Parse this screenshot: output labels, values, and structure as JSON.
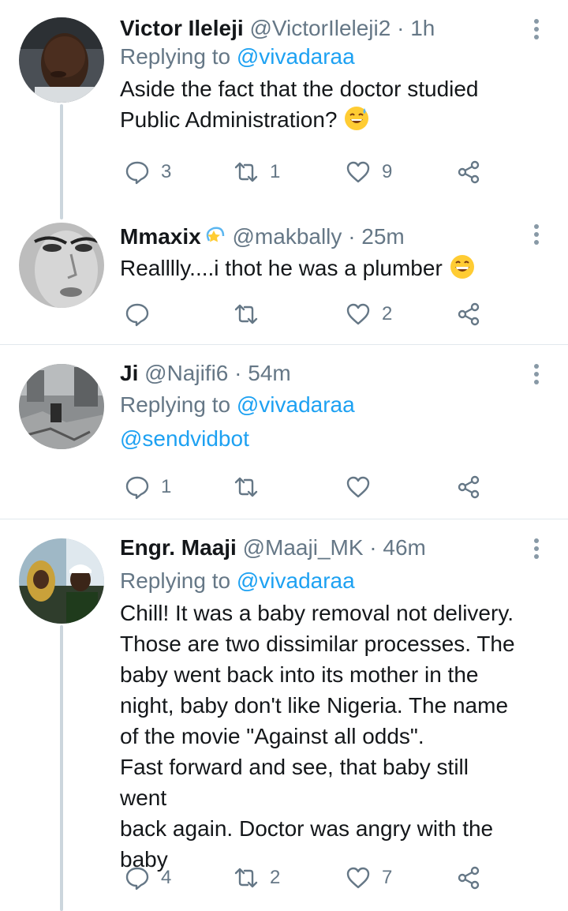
{
  "tweets": [
    {
      "name": "Victor Ileleji",
      "handle": "@VictorIleleji2",
      "time": "· 1h",
      "replying_prefix": "Replying to",
      "replying_to": "@vivadaraa",
      "text_lines": [
        "Aside the fact that the doctor studied",
        "Public Administration?"
      ],
      "emoji": "grinning-sweat-emoji",
      "reply_count": "3",
      "retweet_count": "1",
      "like_count": "9"
    },
    {
      "name": "Mmaxix",
      "handle": "@makbally",
      "time": "· 25m",
      "text": "Realllly....i thot he was a plumber",
      "emoji": "grinning-emoji",
      "badge": "dizzy-star-emoji",
      "reply_count": "",
      "retweet_count": "",
      "like_count": "2"
    },
    {
      "name": "Ji",
      "handle": "@Najifi6",
      "time": "· 54m",
      "replying_prefix": "Replying to",
      "replying_to": "@vivadaraa",
      "text": "@sendvidbot",
      "reply_count": "1",
      "retweet_count": "",
      "like_count": ""
    },
    {
      "name": "Engr. Maaji",
      "handle": "@Maaji_MK",
      "time": "· 46m",
      "replying_prefix": "Replying to",
      "replying_to": "@vivadaraa",
      "text_lines": [
        "Chill! It was a baby removal not delivery.",
        "Those are two dissimilar processes. The",
        "baby went back into its mother in the",
        "night, baby don't like Nigeria. The name",
        "of the movie \"Against all odds\".",
        "Fast forward and see, that baby still went",
        "back again. Doctor was angry with the",
        "baby"
      ],
      "reply_count": "4",
      "retweet_count": "2",
      "like_count": "7"
    }
  ],
  "icons": {
    "reply": "reply-bubble-icon",
    "retweet": "retweet-icon",
    "like": "heart-icon",
    "share": "share-icon",
    "more": "more-vertical-icon"
  },
  "colors": {
    "link": "#1da1f2",
    "muted": "#657786",
    "text": "#14171a",
    "divider": "#e1e8ed",
    "thread": "#ccd6dd"
  }
}
